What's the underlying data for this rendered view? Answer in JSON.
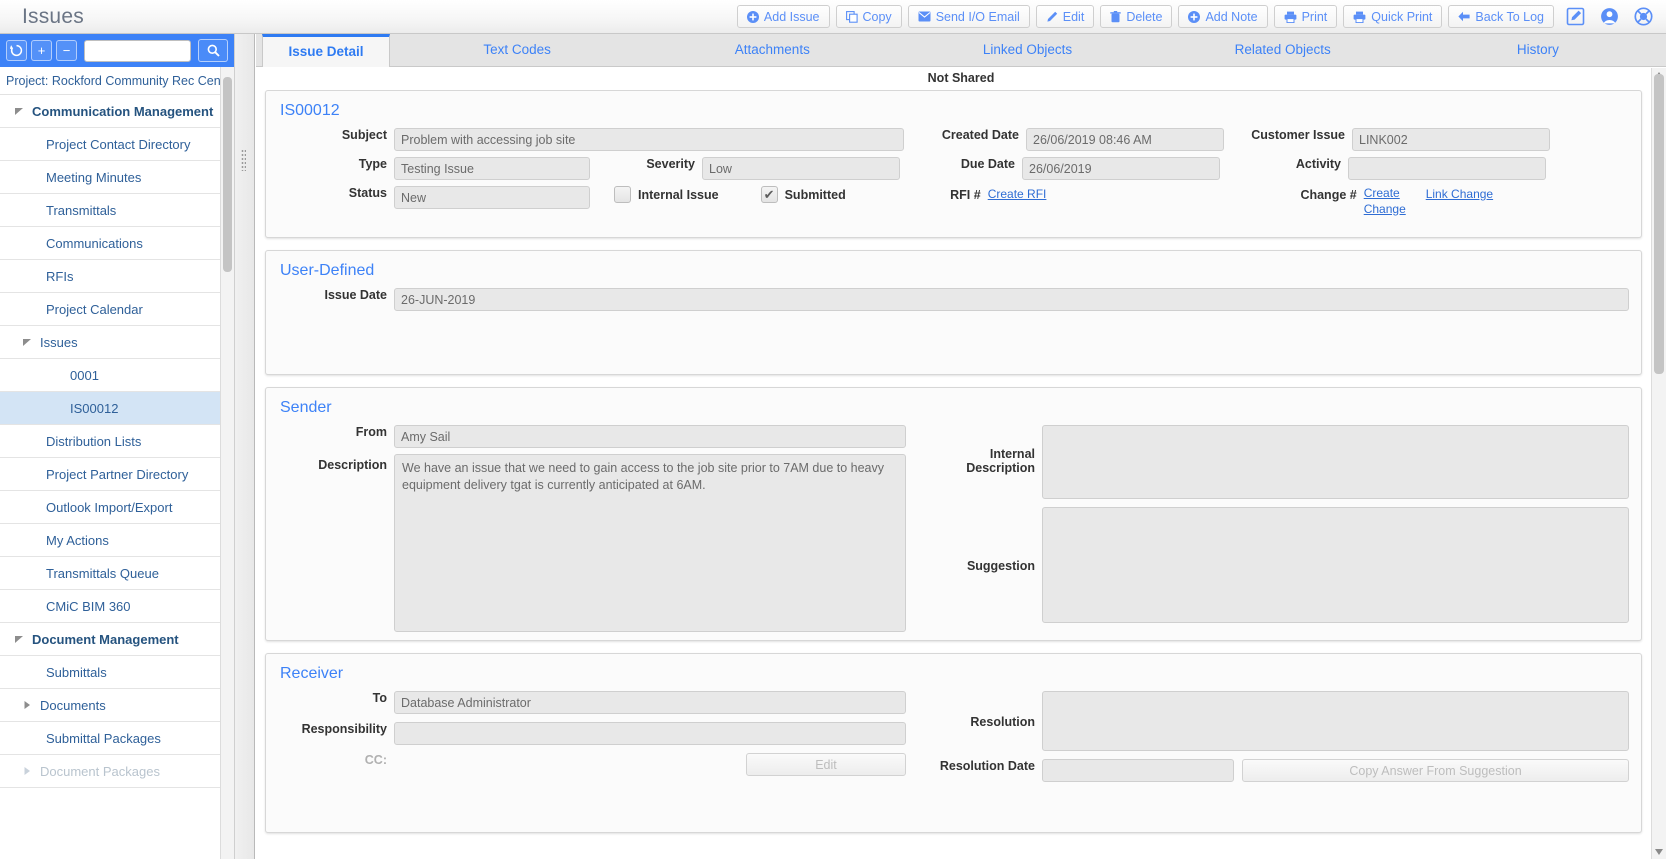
{
  "header": {
    "title": "Issues",
    "buttons": [
      {
        "label": "Add Issue",
        "icon": "plus-circle-icon"
      },
      {
        "label": "Copy",
        "icon": "copy-icon"
      },
      {
        "label": "Send I/O Email",
        "icon": "envelope-icon"
      },
      {
        "label": "Edit",
        "icon": "pencil-icon"
      },
      {
        "label": "Delete",
        "icon": "trash-icon"
      },
      {
        "label": "Add Note",
        "icon": "plus-circle-icon"
      },
      {
        "label": "Print",
        "icon": "printer-icon"
      },
      {
        "label": "Quick Print",
        "icon": "printer-icon"
      },
      {
        "label": "Back To Log",
        "icon": "arrow-left-icon"
      }
    ],
    "icon_buttons": [
      "edit-square-icon",
      "user-circle-icon",
      "lifebuoy-icon"
    ]
  },
  "sidebar": {
    "toolbar": {
      "refresh": "refresh-icon",
      "add": "plus-icon",
      "remove": "minus-icon",
      "search_value": "",
      "search_placeholder": "",
      "search_button": "search-icon"
    },
    "project_label": "Project: Rockford Community Rec Center",
    "items": [
      {
        "label": "Communication Management",
        "level": "group",
        "caret": "down",
        "selected": false,
        "disabled": false
      },
      {
        "label": "Project Contact Directory",
        "level": "lvl1",
        "caret": "none",
        "selected": false,
        "disabled": false
      },
      {
        "label": "Meeting Minutes",
        "level": "lvl1",
        "caret": "none",
        "selected": false,
        "disabled": false
      },
      {
        "label": "Transmittals",
        "level": "lvl1",
        "caret": "none",
        "selected": false,
        "disabled": false
      },
      {
        "label": "Communications",
        "level": "lvl1",
        "caret": "none",
        "selected": false,
        "disabled": false
      },
      {
        "label": "RFIs",
        "level": "lvl1",
        "caret": "none",
        "selected": false,
        "disabled": false
      },
      {
        "label": "Project Calendar",
        "level": "lvl1",
        "caret": "none",
        "selected": false,
        "disabled": false
      },
      {
        "label": "Issues",
        "level": "lvl2",
        "caret": "down",
        "selected": false,
        "disabled": false
      },
      {
        "label": "0001",
        "level": "lvl3",
        "caret": "none",
        "selected": false,
        "disabled": false
      },
      {
        "label": "IS00012",
        "level": "lvl3",
        "caret": "none",
        "selected": true,
        "disabled": false
      },
      {
        "label": "Distribution Lists",
        "level": "lvl1",
        "caret": "none",
        "selected": false,
        "disabled": false
      },
      {
        "label": "Project Partner Directory",
        "level": "lvl1",
        "caret": "none",
        "selected": false,
        "disabled": false
      },
      {
        "label": "Outlook Import/Export",
        "level": "lvl1",
        "caret": "none",
        "selected": false,
        "disabled": false
      },
      {
        "label": "My Actions",
        "level": "lvl1",
        "caret": "none",
        "selected": false,
        "disabled": false
      },
      {
        "label": "Transmittals Queue",
        "level": "lvl1",
        "caret": "none",
        "selected": false,
        "disabled": false
      },
      {
        "label": "CMiC BIM 360",
        "level": "lvl1",
        "caret": "none",
        "selected": false,
        "disabled": false
      },
      {
        "label": "Document Management",
        "level": "group",
        "caret": "down",
        "selected": false,
        "disabled": false
      },
      {
        "label": "Submittals",
        "level": "lvl1",
        "caret": "none",
        "selected": false,
        "disabled": false
      },
      {
        "label": "Documents",
        "level": "lvl2",
        "caret": "right",
        "selected": false,
        "disabled": false
      },
      {
        "label": "Submittal Packages",
        "level": "lvl1",
        "caret": "none",
        "selected": false,
        "disabled": false
      },
      {
        "label": "Document Packages",
        "level": "lvl2",
        "caret": "right",
        "selected": false,
        "disabled": true
      }
    ]
  },
  "main": {
    "tabs": [
      {
        "label": "Issue Detail",
        "active": true
      },
      {
        "label": "Text Codes",
        "active": false
      },
      {
        "label": "Attachments",
        "active": false
      },
      {
        "label": "Linked Objects",
        "active": false
      },
      {
        "label": "Related Objects",
        "active": false
      },
      {
        "label": "History",
        "active": false
      }
    ],
    "shared_status": "Not Shared",
    "detail": {
      "title": "IS00012",
      "subject_label": "Subject",
      "subject_value": "Problem with accessing job site",
      "type_label": "Type",
      "type_value": "Testing Issue",
      "severity_label": "Severity",
      "severity_value": "Low",
      "status_label": "Status",
      "status_value": "New",
      "internal_issue_label": "Internal Issue",
      "internal_issue_checked": false,
      "submitted_label": "Submitted",
      "submitted_checked": true,
      "created_date_label": "Created Date",
      "created_date_value": "26/06/2019 08:46 AM",
      "due_date_label": "Due Date",
      "due_date_value": "26/06/2019",
      "rfi_label": "RFI #",
      "rfi_link": "Create RFI",
      "customer_issue_label": "Customer Issue",
      "customer_issue_value": "LINK002",
      "activity_label": "Activity",
      "activity_value": "",
      "change_label": "Change #",
      "change_link_create": "Create Change",
      "change_link_link": "Link Change"
    },
    "user_defined": {
      "title": "User-Defined",
      "issue_date_label": "Issue Date",
      "issue_date_value": "26-JUN-2019"
    },
    "sender": {
      "title": "Sender",
      "from_label": "From",
      "from_value": "Amy Sail",
      "description_label": "Description",
      "description_value": "We have an issue that we need to gain access to the job site prior to 7AM due to heavy equipment delivery tgat is currently anticipated at 6AM.",
      "internal_description_label": "Internal Description",
      "internal_description_value": "",
      "suggestion_label": "Suggestion",
      "suggestion_value": ""
    },
    "receiver": {
      "title": "Receiver",
      "to_label": "To",
      "to_value": "Database Administrator",
      "responsibility_label": "Responsibility",
      "responsibility_value": "",
      "cc_label": "CC:",
      "cc_edit_button": "Edit",
      "resolution_label": "Resolution",
      "resolution_value": "",
      "resolution_date_label": "Resolution Date",
      "resolution_date_value": "",
      "copy_answer_button": "Copy Answer From Suggestion"
    }
  },
  "colors": {
    "accent": "#3d82f7",
    "link": "#2f6dd4",
    "sidebar_selected": "#d3e4f5",
    "field_bg": "#e8e8e8"
  }
}
